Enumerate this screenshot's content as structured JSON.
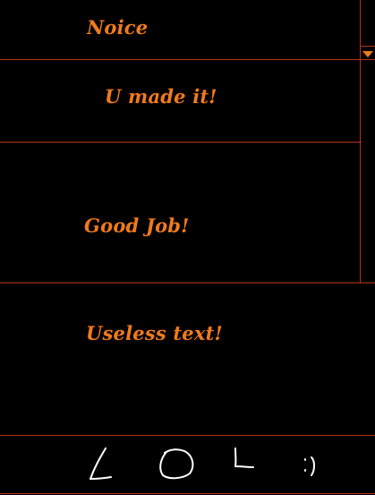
{
  "colors": {
    "background": "#000000",
    "text": "#f07a1c",
    "divider": "#b8321a",
    "scrollbar_arrow": "#f07a1c",
    "doodle": "#ffffff"
  },
  "panels": [
    {
      "text": "Noice"
    },
    {
      "text": "U made it!"
    },
    {
      "text": "Good Job!"
    },
    {
      "text": "Useless text!"
    }
  ],
  "scrollbar": {
    "arrow_icon": "triangle-down-icon"
  },
  "footer": {
    "doodle_text": "LOL :)"
  }
}
